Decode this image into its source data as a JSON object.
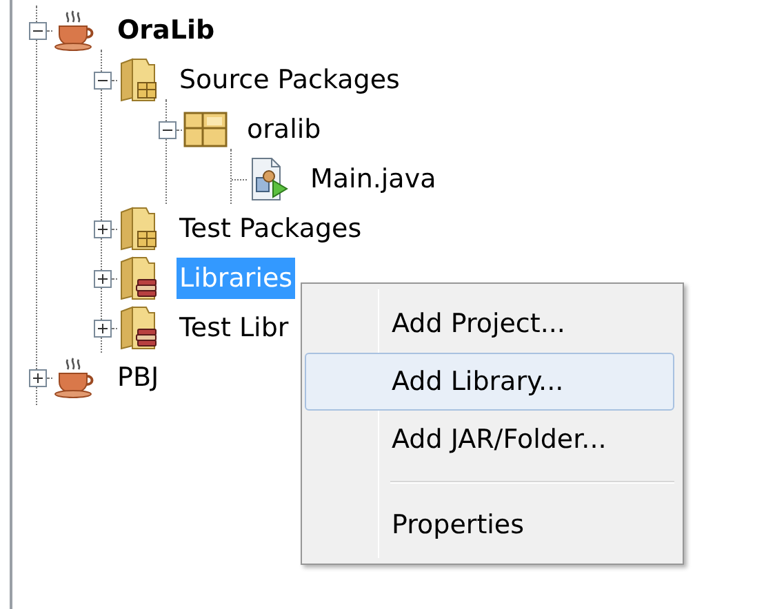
{
  "tree": [
    {
      "kind": "project",
      "label": "OraLib",
      "main": true,
      "expanded": true,
      "selected": false,
      "children": [
        {
          "kind": "source-folder",
          "label": "Source Packages",
          "expanded": true,
          "selected": false,
          "children": [
            {
              "kind": "package",
              "label": "oralib",
              "expanded": true,
              "selected": false,
              "children": [
                {
                  "kind": "java-file",
                  "label": "Main.java",
                  "selected": false
                }
              ]
            }
          ]
        },
        {
          "kind": "source-folder",
          "label": "Test Packages",
          "expanded": false,
          "selected": false
        },
        {
          "kind": "library-folder",
          "label": "Libraries",
          "expanded": false,
          "selected": true
        },
        {
          "kind": "library-folder",
          "label": "Test Libr",
          "expanded": false,
          "selected": false
        }
      ]
    },
    {
      "kind": "project",
      "label": "PBJ",
      "main": false,
      "expanded": false,
      "selected": false
    }
  ],
  "context_menu": {
    "items": [
      {
        "kind": "item",
        "label": "Add Project...",
        "selected": false
      },
      {
        "kind": "item",
        "label": "Add Library...",
        "selected": true
      },
      {
        "kind": "item",
        "label": "Add JAR/Folder...",
        "selected": false
      },
      {
        "kind": "separator"
      },
      {
        "kind": "item",
        "label": "Properties",
        "selected": false
      }
    ]
  }
}
